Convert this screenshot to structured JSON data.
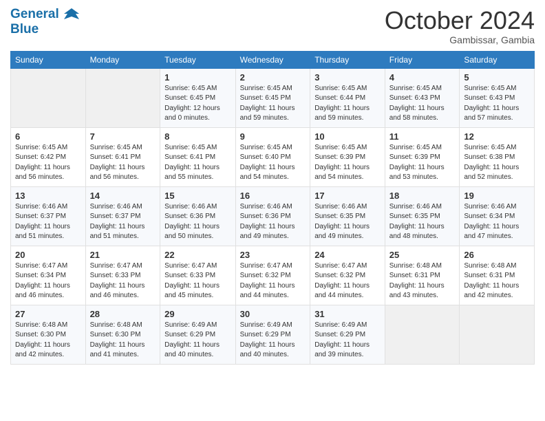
{
  "header": {
    "logo_line1": "General",
    "logo_line2": "Blue",
    "month": "October 2024",
    "location": "Gambissar, Gambia"
  },
  "days_of_week": [
    "Sunday",
    "Monday",
    "Tuesday",
    "Wednesday",
    "Thursday",
    "Friday",
    "Saturday"
  ],
  "weeks": [
    [
      {
        "day": "",
        "content": ""
      },
      {
        "day": "",
        "content": ""
      },
      {
        "day": "1",
        "content": "Sunrise: 6:45 AM\nSunset: 6:45 PM\nDaylight: 12 hours\nand 0 minutes."
      },
      {
        "day": "2",
        "content": "Sunrise: 6:45 AM\nSunset: 6:45 PM\nDaylight: 11 hours\nand 59 minutes."
      },
      {
        "day": "3",
        "content": "Sunrise: 6:45 AM\nSunset: 6:44 PM\nDaylight: 11 hours\nand 59 minutes."
      },
      {
        "day": "4",
        "content": "Sunrise: 6:45 AM\nSunset: 6:43 PM\nDaylight: 11 hours\nand 58 minutes."
      },
      {
        "day": "5",
        "content": "Sunrise: 6:45 AM\nSunset: 6:43 PM\nDaylight: 11 hours\nand 57 minutes."
      }
    ],
    [
      {
        "day": "6",
        "content": "Sunrise: 6:45 AM\nSunset: 6:42 PM\nDaylight: 11 hours\nand 56 minutes."
      },
      {
        "day": "7",
        "content": "Sunrise: 6:45 AM\nSunset: 6:41 PM\nDaylight: 11 hours\nand 56 minutes."
      },
      {
        "day": "8",
        "content": "Sunrise: 6:45 AM\nSunset: 6:41 PM\nDaylight: 11 hours\nand 55 minutes."
      },
      {
        "day": "9",
        "content": "Sunrise: 6:45 AM\nSunset: 6:40 PM\nDaylight: 11 hours\nand 54 minutes."
      },
      {
        "day": "10",
        "content": "Sunrise: 6:45 AM\nSunset: 6:39 PM\nDaylight: 11 hours\nand 54 minutes."
      },
      {
        "day": "11",
        "content": "Sunrise: 6:45 AM\nSunset: 6:39 PM\nDaylight: 11 hours\nand 53 minutes."
      },
      {
        "day": "12",
        "content": "Sunrise: 6:45 AM\nSunset: 6:38 PM\nDaylight: 11 hours\nand 52 minutes."
      }
    ],
    [
      {
        "day": "13",
        "content": "Sunrise: 6:46 AM\nSunset: 6:37 PM\nDaylight: 11 hours\nand 51 minutes."
      },
      {
        "day": "14",
        "content": "Sunrise: 6:46 AM\nSunset: 6:37 PM\nDaylight: 11 hours\nand 51 minutes."
      },
      {
        "day": "15",
        "content": "Sunrise: 6:46 AM\nSunset: 6:36 PM\nDaylight: 11 hours\nand 50 minutes."
      },
      {
        "day": "16",
        "content": "Sunrise: 6:46 AM\nSunset: 6:36 PM\nDaylight: 11 hours\nand 49 minutes."
      },
      {
        "day": "17",
        "content": "Sunrise: 6:46 AM\nSunset: 6:35 PM\nDaylight: 11 hours\nand 49 minutes."
      },
      {
        "day": "18",
        "content": "Sunrise: 6:46 AM\nSunset: 6:35 PM\nDaylight: 11 hours\nand 48 minutes."
      },
      {
        "day": "19",
        "content": "Sunrise: 6:46 AM\nSunset: 6:34 PM\nDaylight: 11 hours\nand 47 minutes."
      }
    ],
    [
      {
        "day": "20",
        "content": "Sunrise: 6:47 AM\nSunset: 6:34 PM\nDaylight: 11 hours\nand 46 minutes."
      },
      {
        "day": "21",
        "content": "Sunrise: 6:47 AM\nSunset: 6:33 PM\nDaylight: 11 hours\nand 46 minutes."
      },
      {
        "day": "22",
        "content": "Sunrise: 6:47 AM\nSunset: 6:33 PM\nDaylight: 11 hours\nand 45 minutes."
      },
      {
        "day": "23",
        "content": "Sunrise: 6:47 AM\nSunset: 6:32 PM\nDaylight: 11 hours\nand 44 minutes."
      },
      {
        "day": "24",
        "content": "Sunrise: 6:47 AM\nSunset: 6:32 PM\nDaylight: 11 hours\nand 44 minutes."
      },
      {
        "day": "25",
        "content": "Sunrise: 6:48 AM\nSunset: 6:31 PM\nDaylight: 11 hours\nand 43 minutes."
      },
      {
        "day": "26",
        "content": "Sunrise: 6:48 AM\nSunset: 6:31 PM\nDaylight: 11 hours\nand 42 minutes."
      }
    ],
    [
      {
        "day": "27",
        "content": "Sunrise: 6:48 AM\nSunset: 6:30 PM\nDaylight: 11 hours\nand 42 minutes."
      },
      {
        "day": "28",
        "content": "Sunrise: 6:48 AM\nSunset: 6:30 PM\nDaylight: 11 hours\nand 41 minutes."
      },
      {
        "day": "29",
        "content": "Sunrise: 6:49 AM\nSunset: 6:29 PM\nDaylight: 11 hours\nand 40 minutes."
      },
      {
        "day": "30",
        "content": "Sunrise: 6:49 AM\nSunset: 6:29 PM\nDaylight: 11 hours\nand 40 minutes."
      },
      {
        "day": "31",
        "content": "Sunrise: 6:49 AM\nSunset: 6:29 PM\nDaylight: 11 hours\nand 39 minutes."
      },
      {
        "day": "",
        "content": ""
      },
      {
        "day": "",
        "content": ""
      }
    ]
  ]
}
